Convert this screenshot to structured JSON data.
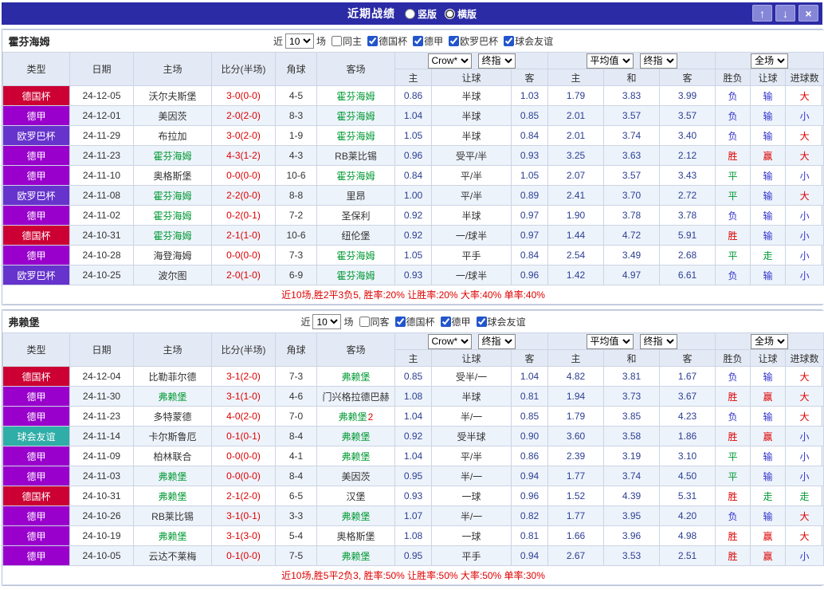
{
  "titlebar": {
    "title": "近期战绩",
    "layout_options": [
      {
        "label": "竖版",
        "selected": false
      },
      {
        "label": "横版",
        "selected": true
      }
    ],
    "buttons": [
      {
        "name": "move-up",
        "glyph": "↑"
      },
      {
        "name": "move-down",
        "glyph": "↓"
      },
      {
        "name": "close",
        "glyph": "×"
      }
    ]
  },
  "colors": {
    "comp": {
      "德国杯": "#cc0033",
      "德甲": "#9900cc",
      "欧罗巴杯": "#6633cc",
      "球会友谊": "#2fada7"
    },
    "result": {
      "胜": "#dd0000",
      "赢": "#dd0000",
      "大": "#dd0000",
      "平": "#009933",
      "走": "#009933",
      "负": "#3333cc",
      "输": "#3333cc",
      "小": "#3333cc"
    }
  },
  "table": {
    "left_columns": [
      "类型",
      "日期",
      "主场",
      "比分(半场)",
      "角球",
      "客场"
    ],
    "group_selects_1": [
      "Crow*",
      "终指"
    ],
    "group_selects_2": [
      "平均值",
      "终指"
    ],
    "group_selects_3": [
      "全场"
    ],
    "odds_columns": [
      "主",
      "让球",
      "客"
    ],
    "avg_columns": [
      "主",
      "和",
      "客"
    ],
    "result_columns": [
      "胜负",
      "让球",
      "进球数"
    ]
  },
  "sections": [
    {
      "team": "霍芬海姆",
      "filter": {
        "prefix": "近",
        "count": "10",
        "suffix": "场",
        "same_side": {
          "label": "同主",
          "checked": false
        },
        "competitions": [
          {
            "label": "德国杯",
            "checked": true
          },
          {
            "label": "德甲",
            "checked": true
          },
          {
            "label": "欧罗巴杯",
            "checked": true
          },
          {
            "label": "球会友谊",
            "checked": true
          }
        ]
      },
      "rows": [
        {
          "comp": "德国杯",
          "date": "24-12-05",
          "home": "沃尔夫斯堡",
          "home_hl": false,
          "score": "3-0(0-0)",
          "corners": "4-5",
          "away": "霍芬海姆",
          "away_hl": true,
          "away_note": "",
          "odds": [
            "0.86",
            "半球",
            "1.03"
          ],
          "avg": [
            "1.79",
            "3.83",
            "3.99"
          ],
          "results": [
            "负",
            "输",
            "大"
          ]
        },
        {
          "comp": "德甲",
          "date": "24-12-01",
          "home": "美因茨",
          "home_hl": false,
          "score": "2-0(2-0)",
          "corners": "8-3",
          "away": "霍芬海姆",
          "away_hl": true,
          "away_note": "",
          "odds": [
            "1.04",
            "半球",
            "0.85"
          ],
          "avg": [
            "2.01",
            "3.57",
            "3.57"
          ],
          "results": [
            "负",
            "输",
            "小"
          ]
        },
        {
          "comp": "欧罗巴杯",
          "date": "24-11-29",
          "home": "布拉加",
          "home_hl": false,
          "score": "3-0(2-0)",
          "corners": "1-9",
          "away": "霍芬海姆",
          "away_hl": true,
          "away_note": "",
          "odds": [
            "1.05",
            "半球",
            "0.84"
          ],
          "avg": [
            "2.01",
            "3.74",
            "3.40"
          ],
          "results": [
            "负",
            "输",
            "大"
          ]
        },
        {
          "comp": "德甲",
          "date": "24-11-23",
          "home": "霍芬海姆",
          "home_hl": true,
          "score": "4-3(1-2)",
          "corners": "4-3",
          "away": "RB莱比锡",
          "away_hl": false,
          "away_note": "",
          "odds": [
            "0.96",
            "受平/半",
            "0.93"
          ],
          "avg": [
            "3.25",
            "3.63",
            "2.12"
          ],
          "results": [
            "胜",
            "赢",
            "大"
          ]
        },
        {
          "comp": "德甲",
          "date": "24-11-10",
          "home": "奥格斯堡",
          "home_hl": false,
          "score": "0-0(0-0)",
          "corners": "10-6",
          "away": "霍芬海姆",
          "away_hl": true,
          "away_note": "",
          "odds": [
            "0.84",
            "平/半",
            "1.05"
          ],
          "avg": [
            "2.07",
            "3.57",
            "3.43"
          ],
          "results": [
            "平",
            "输",
            "小"
          ]
        },
        {
          "comp": "欧罗巴杯",
          "date": "24-11-08",
          "home": "霍芬海姆",
          "home_hl": true,
          "score": "2-2(0-0)",
          "corners": "8-8",
          "away": "里昂",
          "away_hl": false,
          "away_note": "",
          "odds": [
            "1.00",
            "平/半",
            "0.89"
          ],
          "avg": [
            "2.41",
            "3.70",
            "2.72"
          ],
          "results": [
            "平",
            "输",
            "大"
          ]
        },
        {
          "comp": "德甲",
          "date": "24-11-02",
          "home": "霍芬海姆",
          "home_hl": true,
          "score": "0-2(0-1)",
          "corners": "7-2",
          "away": "圣保利",
          "away_hl": false,
          "away_note": "",
          "odds": [
            "0.92",
            "半球",
            "0.97"
          ],
          "avg": [
            "1.90",
            "3.78",
            "3.78"
          ],
          "results": [
            "负",
            "输",
            "小"
          ]
        },
        {
          "comp": "德国杯",
          "date": "24-10-31",
          "home": "霍芬海姆",
          "home_hl": true,
          "score": "2-1(1-0)",
          "corners": "10-6",
          "away": "纽伦堡",
          "away_hl": false,
          "away_note": "",
          "odds": [
            "0.92",
            "一/球半",
            "0.97"
          ],
          "avg": [
            "1.44",
            "4.72",
            "5.91"
          ],
          "results": [
            "胜",
            "输",
            "小"
          ]
        },
        {
          "comp": "德甲",
          "date": "24-10-28",
          "home": "海登海姆",
          "home_hl": false,
          "score": "0-0(0-0)",
          "corners": "7-3",
          "away": "霍芬海姆",
          "away_hl": true,
          "away_note": "",
          "odds": [
            "1.05",
            "平手",
            "0.84"
          ],
          "avg": [
            "2.54",
            "3.49",
            "2.68"
          ],
          "results": [
            "平",
            "走",
            "小"
          ]
        },
        {
          "comp": "欧罗巴杯",
          "date": "24-10-25",
          "home": "波尔图",
          "home_hl": false,
          "score": "2-0(1-0)",
          "corners": "6-9",
          "away": "霍芬海姆",
          "away_hl": true,
          "away_note": "",
          "odds": [
            "0.93",
            "一/球半",
            "0.96"
          ],
          "avg": [
            "1.42",
            "4.97",
            "6.61"
          ],
          "results": [
            "负",
            "输",
            "小"
          ]
        }
      ],
      "summary": "近10场,胜2平3负5, 胜率:20% 让胜率:20% 大率:40% 单率:40%"
    },
    {
      "team": "弗赖堡",
      "filter": {
        "prefix": "近",
        "count": "10",
        "suffix": "场",
        "same_side": {
          "label": "同客",
          "checked": false
        },
        "competitions": [
          {
            "label": "德国杯",
            "checked": true
          },
          {
            "label": "德甲",
            "checked": true
          },
          {
            "label": "球会友谊",
            "checked": true
          }
        ]
      },
      "rows": [
        {
          "comp": "德国杯",
          "date": "24-12-04",
          "home": "比勒菲尔德",
          "home_hl": false,
          "score": "3-1(2-0)",
          "corners": "7-3",
          "away": "弗赖堡",
          "away_hl": true,
          "away_note": "",
          "odds": [
            "0.85",
            "受半/一",
            "1.04"
          ],
          "avg": [
            "4.82",
            "3.81",
            "1.67"
          ],
          "results": [
            "负",
            "输",
            "大"
          ]
        },
        {
          "comp": "德甲",
          "date": "24-11-30",
          "home": "弗赖堡",
          "home_hl": true,
          "score": "3-1(1-0)",
          "corners": "4-6",
          "away": "门兴格拉德巴赫",
          "away_hl": false,
          "away_note": "",
          "odds": [
            "1.08",
            "半球",
            "0.81"
          ],
          "avg": [
            "1.94",
            "3.73",
            "3.67"
          ],
          "results": [
            "胜",
            "赢",
            "大"
          ]
        },
        {
          "comp": "德甲",
          "date": "24-11-23",
          "home": "多特蒙德",
          "home_hl": false,
          "score": "4-0(2-0)",
          "corners": "7-0",
          "away": "弗赖堡",
          "away_hl": true,
          "away_note": "2",
          "odds": [
            "1.04",
            "半/一",
            "0.85"
          ],
          "avg": [
            "1.79",
            "3.85",
            "4.23"
          ],
          "results": [
            "负",
            "输",
            "大"
          ]
        },
        {
          "comp": "球会友谊",
          "date": "24-11-14",
          "home": "卡尔斯鲁厄",
          "home_hl": false,
          "score": "0-1(0-1)",
          "corners": "8-4",
          "away": "弗赖堡",
          "away_hl": true,
          "away_note": "",
          "odds": [
            "0.92",
            "受半球",
            "0.90"
          ],
          "avg": [
            "3.60",
            "3.58",
            "1.86"
          ],
          "results": [
            "胜",
            "赢",
            "小"
          ]
        },
        {
          "comp": "德甲",
          "date": "24-11-09",
          "home": "柏林联合",
          "home_hl": false,
          "score": "0-0(0-0)",
          "corners": "4-1",
          "away": "弗赖堡",
          "away_hl": true,
          "away_note": "",
          "odds": [
            "1.04",
            "平/半",
            "0.86"
          ],
          "avg": [
            "2.39",
            "3.19",
            "3.10"
          ],
          "results": [
            "平",
            "输",
            "小"
          ]
        },
        {
          "comp": "德甲",
          "date": "24-11-03",
          "home": "弗赖堡",
          "home_hl": true,
          "score": "0-0(0-0)",
          "corners": "8-4",
          "away": "美因茨",
          "away_hl": false,
          "away_note": "",
          "odds": [
            "0.95",
            "半/一",
            "0.94"
          ],
          "avg": [
            "1.77",
            "3.74",
            "4.50"
          ],
          "results": [
            "平",
            "输",
            "小"
          ]
        },
        {
          "comp": "德国杯",
          "date": "24-10-31",
          "home": "弗赖堡",
          "home_hl": true,
          "score": "2-1(2-0)",
          "corners": "6-5",
          "away": "汉堡",
          "away_hl": false,
          "away_note": "",
          "odds": [
            "0.93",
            "一球",
            "0.96"
          ],
          "avg": [
            "1.52",
            "4.39",
            "5.31"
          ],
          "results": [
            "胜",
            "走",
            "走"
          ]
        },
        {
          "comp": "德甲",
          "date": "24-10-26",
          "home": "RB莱比锡",
          "home_hl": false,
          "score": "3-1(0-1)",
          "corners": "3-3",
          "away": "弗赖堡",
          "away_hl": true,
          "away_note": "",
          "odds": [
            "1.07",
            "半/一",
            "0.82"
          ],
          "avg": [
            "1.77",
            "3.95",
            "4.20"
          ],
          "results": [
            "负",
            "输",
            "大"
          ]
        },
        {
          "comp": "德甲",
          "date": "24-10-19",
          "home": "弗赖堡",
          "home_hl": true,
          "score": "3-1(3-0)",
          "corners": "5-4",
          "away": "奥格斯堡",
          "away_hl": false,
          "away_note": "",
          "odds": [
            "1.08",
            "一球",
            "0.81"
          ],
          "avg": [
            "1.66",
            "3.96",
            "4.98"
          ],
          "results": [
            "胜",
            "赢",
            "大"
          ]
        },
        {
          "comp": "德甲",
          "date": "24-10-05",
          "home": "云达不莱梅",
          "home_hl": false,
          "score": "0-1(0-0)",
          "corners": "7-5",
          "away": "弗赖堡",
          "away_hl": true,
          "away_note": "",
          "odds": [
            "0.95",
            "平手",
            "0.94"
          ],
          "avg": [
            "2.67",
            "3.53",
            "2.51"
          ],
          "results": [
            "胜",
            "赢",
            "小"
          ]
        }
      ],
      "summary": "近10场,胜5平2负3, 胜率:50% 让胜率:50% 大率:50% 单率:30%"
    }
  ]
}
